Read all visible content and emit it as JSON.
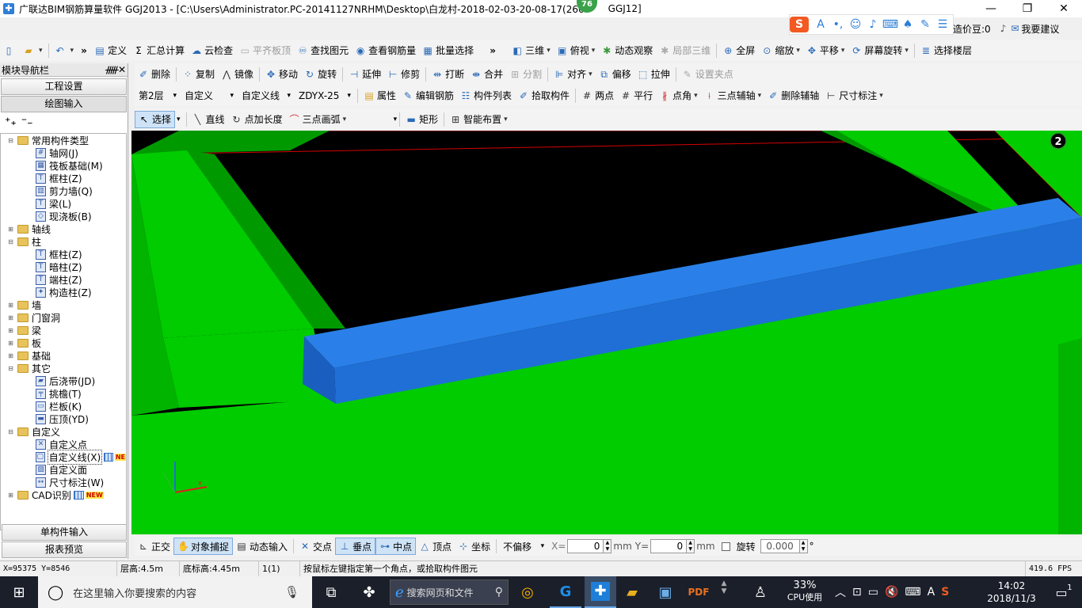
{
  "window": {
    "title": "广联达BIM钢筋算量软件 GGJ2013 - [C:\\Users\\Administrator.PC-20141127NRHM\\Desktop\\白龙村-2018-02-03-20-08-17(266",
    "title_tail": "GGJ12]",
    "badge": "76",
    "min": "—",
    "max": "❐",
    "close": "✕"
  },
  "top_right": {
    "price_label": "造价豆:0",
    "suggest_label": "我要建议"
  },
  "toolbar1": {
    "items": [
      "定义",
      "汇总计算",
      "云检查",
      "平齐板顶",
      "查找图元",
      "查看钢筋量",
      "批量选择"
    ],
    "right_items": [
      "三维",
      "俯视",
      "动态观察",
      "局部三维",
      "全屏",
      "缩放",
      "平移",
      "屏幕旋转",
      "选择楼层"
    ]
  },
  "toolbar2": {
    "items": [
      "删除",
      "复制",
      "镜像",
      "移动",
      "旋转",
      "延伸",
      "修剪",
      "打断",
      "合并",
      "分割",
      "对齐",
      "偏移",
      "拉伸",
      "设置夹点"
    ]
  },
  "toolbar3": {
    "floor": "第2层",
    "category": "自定义",
    "type": "自定义线",
    "element": "ZDYX-25",
    "items": [
      "属性",
      "编辑钢筋",
      "构件列表",
      "拾取构件",
      "两点",
      "平行",
      "点角",
      "三点辅轴",
      "删除辅轴",
      "尺寸标注"
    ]
  },
  "toolbar4": {
    "select": "选择",
    "items": [
      "直线",
      "点加长度",
      "三点画弧",
      "矩形",
      "智能布置"
    ]
  },
  "nav": {
    "title": "模块导航栏",
    "pin": "ᚏ",
    "close": "✕",
    "btn_project": "工程设置",
    "btn_draw": "绘图输入",
    "btn_single": "单构件输入",
    "btn_report": "报表预览",
    "tree": [
      {
        "level": 0,
        "exp": "⊟",
        "kind": "folder",
        "label": "常用构件类型"
      },
      {
        "level": 1,
        "kind": "comp",
        "icon": "#",
        "label": "轴网(J)"
      },
      {
        "level": 1,
        "kind": "comp",
        "icon": "▦",
        "label": "筏板基础(M)"
      },
      {
        "level": 1,
        "kind": "comp",
        "icon": "T",
        "label": "框柱(Z)"
      },
      {
        "level": 1,
        "kind": "comp",
        "icon": "▥",
        "label": "剪力墙(Q)"
      },
      {
        "level": 1,
        "kind": "comp",
        "icon": "T",
        "label": "梁(L)"
      },
      {
        "level": 1,
        "kind": "comp",
        "icon": "◇",
        "label": "现浇板(B)"
      },
      {
        "level": 0,
        "exp": "⊞",
        "kind": "folder",
        "label": "轴线"
      },
      {
        "level": 0,
        "exp": "⊟",
        "kind": "folder",
        "label": "柱"
      },
      {
        "level": 1,
        "kind": "comp",
        "icon": "T",
        "label": "框柱(Z)"
      },
      {
        "level": 1,
        "kind": "comp",
        "icon": "T",
        "label": "暗柱(Z)"
      },
      {
        "level": 1,
        "kind": "comp",
        "icon": "T",
        "label": "端柱(Z)"
      },
      {
        "level": 1,
        "kind": "comp",
        "icon": "✦",
        "label": "构造柱(Z)"
      },
      {
        "level": 0,
        "exp": "⊞",
        "kind": "folder",
        "label": "墙"
      },
      {
        "level": 0,
        "exp": "⊞",
        "kind": "folder",
        "label": "门窗洞"
      },
      {
        "level": 0,
        "exp": "⊞",
        "kind": "folder",
        "label": "梁"
      },
      {
        "level": 0,
        "exp": "⊞",
        "kind": "folder",
        "label": "板"
      },
      {
        "level": 0,
        "exp": "⊞",
        "kind": "folder",
        "label": "基础"
      },
      {
        "level": 0,
        "exp": "⊟",
        "kind": "folder",
        "label": "其它"
      },
      {
        "level": 1,
        "kind": "comp",
        "icon": "▰",
        "label": "后浇带(JD)"
      },
      {
        "level": 1,
        "kind": "comp",
        "icon": "╤",
        "label": "挑檐(T)"
      },
      {
        "level": 1,
        "kind": "comp",
        "icon": "▭",
        "label": "栏板(K)"
      },
      {
        "level": 1,
        "kind": "comp",
        "icon": "▬",
        "label": "压顶(YD)"
      },
      {
        "level": 0,
        "exp": "⊟",
        "kind": "folder",
        "label": "自定义"
      },
      {
        "level": 1,
        "kind": "comp",
        "icon": "✕",
        "label": "自定义点"
      },
      {
        "level": 1,
        "kind": "comp",
        "icon": "▢",
        "label": "自定义线(X)",
        "selected": true,
        "grid": true,
        "new": "NE"
      },
      {
        "level": 1,
        "kind": "comp",
        "icon": "▨",
        "label": "自定义面"
      },
      {
        "level": 1,
        "kind": "comp",
        "icon": "↔",
        "label": "尺寸标注(W)"
      },
      {
        "level": 0,
        "exp": "⊞",
        "kind": "folder",
        "label": "CAD识别",
        "grid": true,
        "new": "NEW"
      }
    ]
  },
  "viewport": {
    "view_label": "2",
    "colors": {
      "bg": "#000000",
      "slab": "#00cc00",
      "slab_dark": "#009a00",
      "beam": "#1f6fd6",
      "beam_top": "#2a80e8",
      "grid": "#d60000"
    }
  },
  "snapbar": {
    "items": [
      "正交",
      "对象捕捉",
      "动态输入",
      "交点",
      "垂点",
      "中点",
      "顶点",
      "坐标"
    ],
    "offset_mode": "不偏移",
    "x_label": "X=",
    "x_value": "0",
    "y_label": "Y=",
    "y_value": "0",
    "mm": "mm",
    "rotate_label": "旋转",
    "rotate_value": "0.000",
    "degree": "°"
  },
  "status": {
    "coords": "X=95375 Y=8546",
    "floor_height": "层高:4.5m",
    "base_height": "底标高:4.45m",
    "count": "1(1)",
    "hint": "按鼠标左键指定第一个角点，或拾取构件图元",
    "fps": "419.6 FPS"
  },
  "taskbar": {
    "search_placeholder": "在这里输入你要搜索的内容",
    "edge_search": "搜索网页和文件",
    "cpu_percent": "33%",
    "cpu_label": "CPU使用",
    "ime": "A",
    "time": "14:02",
    "date": "2018/11/3",
    "notif_count": "1"
  }
}
